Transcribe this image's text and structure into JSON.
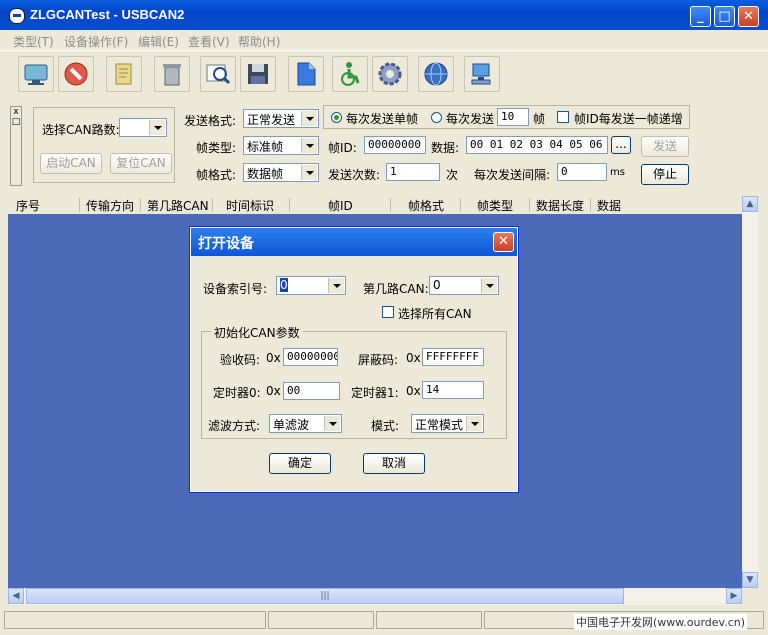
{
  "window": {
    "title": "ZLGCANTest - USBCAN2"
  },
  "menu": [
    "类型(T)",
    "设备操作(F)",
    "编辑(E)",
    "查看(V)",
    "帮助(H)"
  ],
  "toolbar": {
    "icons": [
      "monitor-icon",
      "stop-icon",
      "clear-icon",
      "trash-icon",
      "filter-icon",
      "save-disk-icon",
      "document-icon",
      "accessibility-icon",
      "gear-icon",
      "globe-icon",
      "network-icon"
    ]
  },
  "control": {
    "can_channel_label": "选择CAN路数:",
    "start_can": "启动CAN",
    "reset_can": "复位CAN",
    "send_format_label": "发送格式:",
    "send_format_value": "正常发送",
    "frame_type_label": "帧类型:",
    "frame_type_value": "标准帧",
    "frame_format_label": "帧格式:",
    "frame_format_value": "数据帧",
    "radio_single": "每次发送单帧",
    "radio_multi": "每次发送",
    "multi_count": "10",
    "frame_unit": "帧",
    "increment_id": "帧ID每发送一帧递增",
    "frame_id_label": "帧ID:",
    "frame_id_value": "00000000",
    "data_label": "数据:",
    "data_value": "00 01 02 03 04 05 06 07",
    "more_button": "...",
    "send_button": "发送",
    "send_count_label": "发送次数:",
    "send_count_value": "1",
    "send_count_unit": "次",
    "interval_label": "每次发送间隔:",
    "interval_value": "0",
    "interval_unit": "ms",
    "stop_button": "停止"
  },
  "list": {
    "columns": [
      "序号",
      "传输方向",
      "第几路CAN",
      "时间标识",
      "帧ID",
      "帧格式",
      "帧类型",
      "数据长度",
      "数据"
    ],
    "scroll_thumb": "|||"
  },
  "status": {
    "watermark": "中国电子开发网(www.ourdev.cn)"
  },
  "dialog": {
    "title": "打开设备",
    "device_index_label": "设备索引号:",
    "device_index_value": "0",
    "can_index_label": "第几路CAN:",
    "can_index_value": "0",
    "select_all_can": "选择所有CAN",
    "init_group": "初始化CAN参数",
    "acc_code_label": "验收码:",
    "acc_code_prefix": "0x",
    "acc_code_value": "00000000",
    "mask_label": "屏蔽码:",
    "mask_prefix": "0x",
    "mask_value": "FFFFFFFF",
    "timer0_label": "定时器0:",
    "timer0_prefix": "0x",
    "timer0_value": "00",
    "timer1_label": "定时器1:",
    "timer1_prefix": "0x",
    "timer1_value": "14",
    "filter_label": "滤波方式:",
    "filter_value": "单滤波",
    "mode_label": "模式:",
    "mode_value": "正常模式",
    "ok_button": "确定",
    "cancel_button": "取消"
  }
}
